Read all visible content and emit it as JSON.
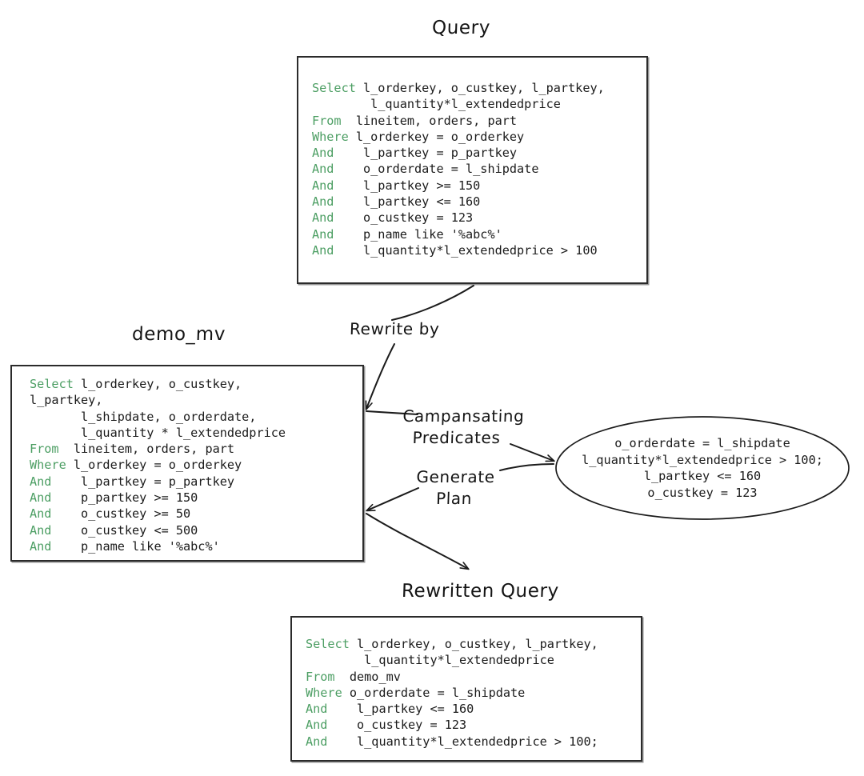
{
  "diagram": {
    "titles": {
      "query": "Query",
      "demo_mv": "demo_mv",
      "rewritten_query": "Rewritten Query"
    },
    "edge_labels": {
      "rewrite_by": "Rewrite by",
      "compensating_predicates_line1": "Campansating",
      "compensating_predicates_line2": "Predicates",
      "generate_plan_line1": "Generate",
      "generate_plan_line2": "Plan"
    },
    "colors": {
      "keyword_green": "#4c9e63",
      "text_black": "#1b1b1b",
      "border": "#2b2b2b",
      "background": "#ffffff"
    },
    "query_box": {
      "lines": [
        {
          "kw": "Select",
          "rest": " l_orderkey, o_custkey, l_partkey,"
        },
        {
          "kw": "",
          "rest": "        l_quantity*l_extendedprice"
        },
        {
          "kw": "From",
          "rest": "  lineitem, orders, part"
        },
        {
          "kw": "Where",
          "rest": " l_orderkey = o_orderkey"
        },
        {
          "kw": "And",
          "rest": "    l_partkey = p_partkey"
        },
        {
          "kw": "And",
          "rest": "    o_orderdate = l_shipdate"
        },
        {
          "kw": "And",
          "rest": "    l_partkey >= 150"
        },
        {
          "kw": "And",
          "rest": "    l_partkey <= 160"
        },
        {
          "kw": "And",
          "rest": "    o_custkey = 123"
        },
        {
          "kw": "And",
          "rest": "    p_name like '%abc%'"
        },
        {
          "kw": "And",
          "rest": "    l_quantity*l_extendedprice > 100"
        }
      ]
    },
    "demo_mv_box": {
      "lines": [
        {
          "kw": "Select",
          "rest": " l_orderkey, o_custkey,"
        },
        {
          "kw": "",
          "rest": "l_partkey,"
        },
        {
          "kw": "",
          "rest": "       l_shipdate, o_orderdate,"
        },
        {
          "kw": "",
          "rest": "       l_quantity * l_extendedprice"
        },
        {
          "kw": "From",
          "rest": "  lineitem, orders, part"
        },
        {
          "kw": "Where",
          "rest": " l_orderkey = o_orderkey"
        },
        {
          "kw": "And",
          "rest": "    l_partkey = p_partkey"
        },
        {
          "kw": "And",
          "rest": "    p_partkey >= 150"
        },
        {
          "kw": "And",
          "rest": "    o_custkey >= 50"
        },
        {
          "kw": "And",
          "rest": "    o_custkey <= 500"
        },
        {
          "kw": "And",
          "rest": "    p_name like '%abc%'"
        }
      ]
    },
    "rewritten_query_box": {
      "lines": [
        {
          "kw": "Select",
          "rest": " l_orderkey, o_custkey, l_partkey,"
        },
        {
          "kw": "",
          "rest": "        l_quantity*l_extendedprice"
        },
        {
          "kw": "From",
          "rest": "  demo_mv"
        },
        {
          "kw": "Where",
          "rest": " o_orderdate = l_shipdate"
        },
        {
          "kw": "And",
          "rest": "    l_partkey <= 160"
        },
        {
          "kw": "And",
          "rest": "    o_custkey = 123"
        },
        {
          "kw": "And",
          "rest": "    l_quantity*l_extendedprice > 100;"
        }
      ]
    },
    "compensating_predicates_ellipse": {
      "lines": [
        "o_orderdate = l_shipdate",
        "l_quantity*l_extendedprice > 100;",
        "l_partkey <= 160",
        "o_custkey = 123"
      ]
    }
  }
}
